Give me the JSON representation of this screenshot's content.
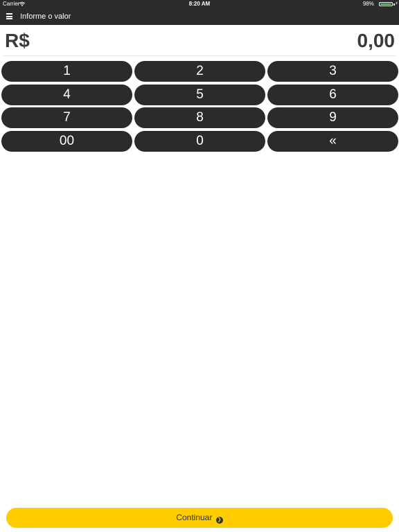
{
  "status_bar": {
    "carrier": "Carrier",
    "time": "8:20 AM",
    "battery_percent": "98%",
    "battery_level": 0.98,
    "battery_color": "#4cd964"
  },
  "navbar": {
    "menu_icon": "hamburger-menu-icon",
    "title": "Informe o valor"
  },
  "amount": {
    "currency": "R$",
    "value": "0,00"
  },
  "keypad": {
    "keys": [
      "1",
      "2",
      "3",
      "4",
      "5",
      "6",
      "7",
      "8",
      "9",
      "00",
      "0",
      "«"
    ]
  },
  "footer": {
    "continue_label": "Continuar",
    "continue_icon": "chevron-circle-right-icon",
    "accent_color": "#ffcc00"
  },
  "colors": {
    "bar": "#2b2b2b",
    "key": "#2b2b2b",
    "text_dark": "#3a3a3a"
  }
}
